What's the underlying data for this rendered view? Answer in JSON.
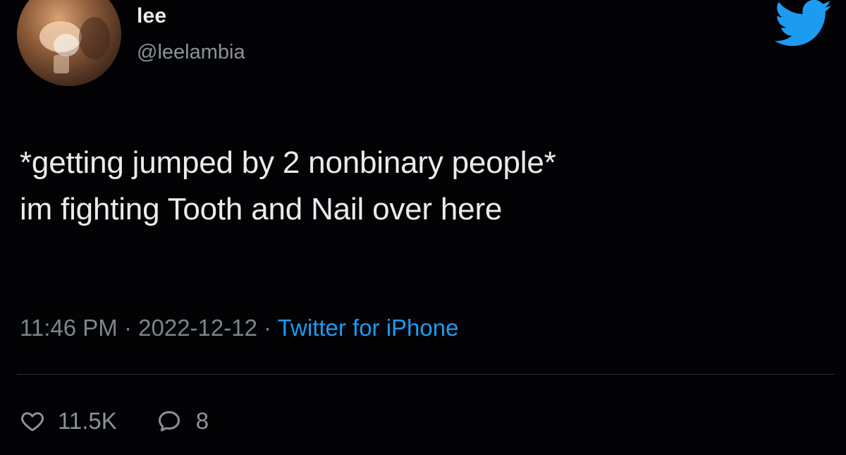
{
  "author": {
    "display_name": "lee",
    "handle": "@leelambia",
    "avatar_icon": "profile-photo"
  },
  "brand": {
    "icon": "twitter-bird-icon",
    "color": "#1d9bf0"
  },
  "tweet": {
    "lines": [
      "*getting jumped by 2 nonbinary people*",
      "im fighting Tooth and Nail over here"
    ]
  },
  "meta": {
    "time": "11:46 PM",
    "separator_1": " · ",
    "date": "2022-12-12",
    "separator_2": " · ",
    "source": "Twitter for iPhone"
  },
  "stats": {
    "likes": "11.5K",
    "like_icon": "heart-icon",
    "replies": "8",
    "reply_icon": "speech-bubble-icon"
  }
}
